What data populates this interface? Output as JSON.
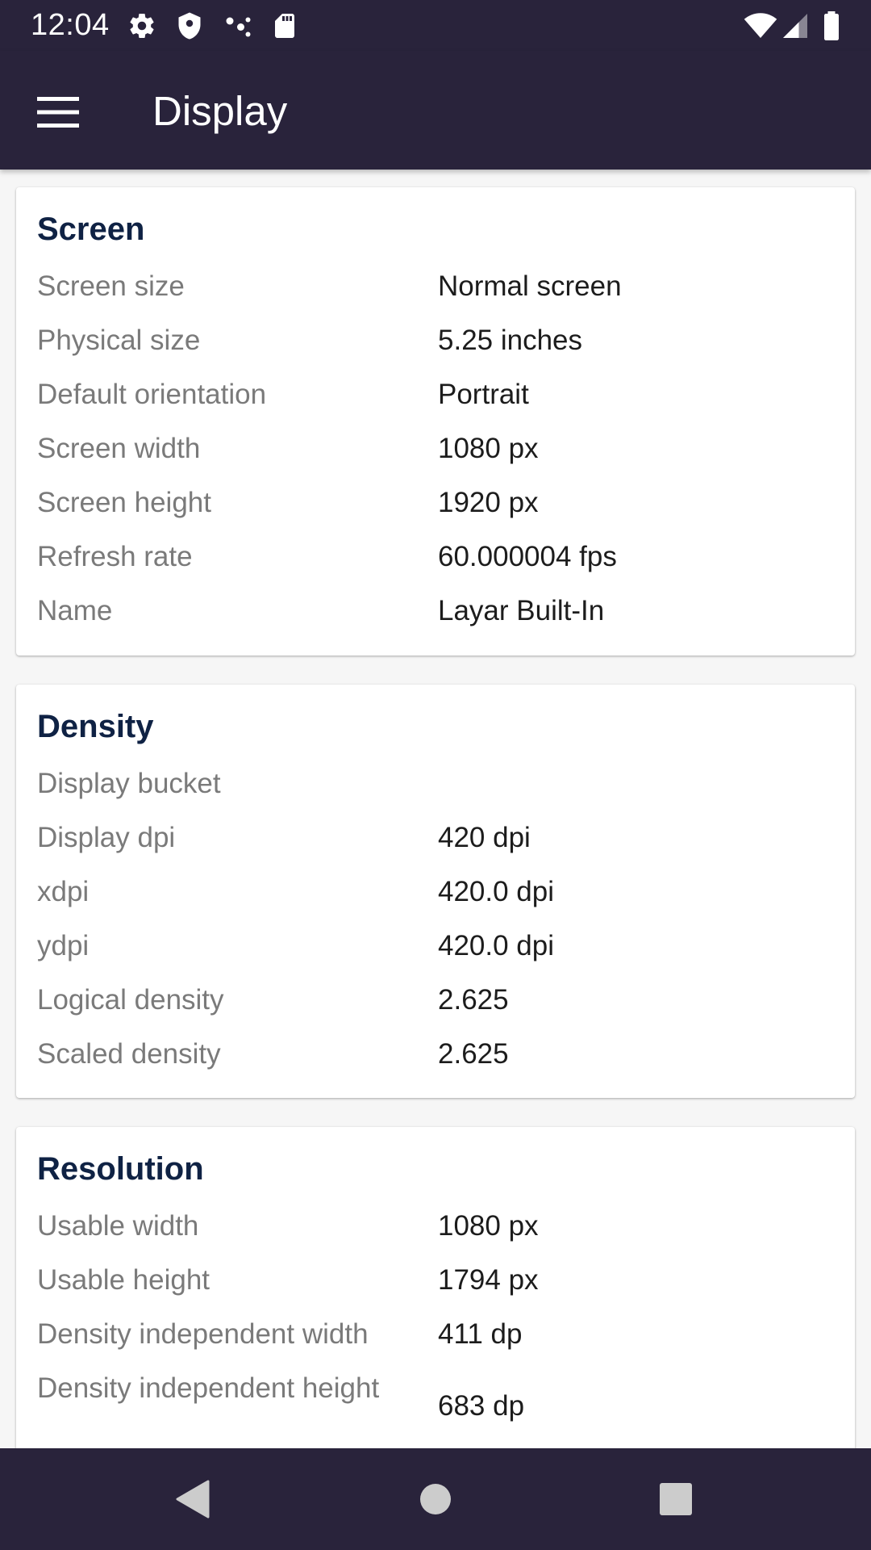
{
  "status_bar": {
    "time": "12:04",
    "left_icons": [
      "settings-gear-icon",
      "shield-icon",
      "dots-icon",
      "sd-card-icon"
    ],
    "right_icons": [
      "wifi-icon",
      "cell-signal-icon",
      "battery-icon"
    ]
  },
  "app_bar": {
    "title": "Display",
    "menu_icon": "hamburger-menu-icon"
  },
  "colors": {
    "bar_background": "#29233b",
    "card_title": "#0f2244",
    "label": "#7a7a7a",
    "value": "#1c1c1c",
    "page_background": "#f6f6f6"
  },
  "sections": [
    {
      "title": "Screen",
      "rows": [
        {
          "label": "Screen size",
          "value": "Normal screen"
        },
        {
          "label": "Physical size",
          "value": "5.25 inches"
        },
        {
          "label": "Default orientation",
          "value": "Portrait"
        },
        {
          "label": "Screen width",
          "value": "1080 px"
        },
        {
          "label": "Screen height",
          "value": "1920 px"
        },
        {
          "label": "Refresh rate",
          "value": "60.000004 fps"
        },
        {
          "label": "Name",
          "value": "Layar Built-In"
        }
      ]
    },
    {
      "title": "Density",
      "rows": [
        {
          "label": "Display bucket",
          "value": ""
        },
        {
          "label": "Display dpi",
          "value": "420 dpi"
        },
        {
          "label": "xdpi",
          "value": "420.0 dpi"
        },
        {
          "label": "ydpi",
          "value": "420.0 dpi"
        },
        {
          "label": "Logical density",
          "value": "2.625"
        },
        {
          "label": "Scaled density",
          "value": "2.625"
        }
      ]
    },
    {
      "title": "Resolution",
      "rows": [
        {
          "label": "Usable width",
          "value": "1080 px"
        },
        {
          "label": "Usable height",
          "value": "1794 px"
        },
        {
          "label": "Density independent width",
          "value": "411 dp"
        },
        {
          "label": "Density independent height",
          "value": "683 dp"
        }
      ]
    }
  ],
  "nav_bar": {
    "icons": [
      "back-icon",
      "home-icon",
      "recents-icon"
    ]
  }
}
